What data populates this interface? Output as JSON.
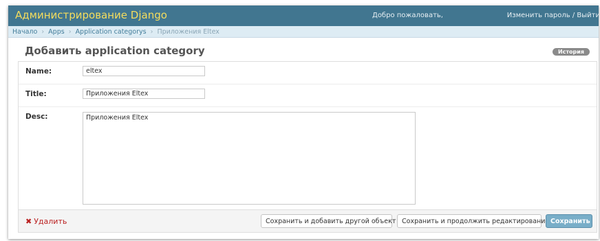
{
  "header": {
    "site_title": "Администрирование Django",
    "welcome": "Добро пожаловать,",
    "change_password": "Изменить пароль",
    "separator": "/",
    "logout": "Выйти"
  },
  "breadcrumbs": {
    "items": [
      "Начало",
      "Apps",
      "Application categorys",
      "Приложения Eltex"
    ],
    "separator": "›"
  },
  "page": {
    "title": "Добавить application category",
    "history_label": "История"
  },
  "form": {
    "name": {
      "label": "Name:",
      "value": "eltex"
    },
    "title": {
      "label": "Title:",
      "value": "Приложения Eltex"
    },
    "desc": {
      "label": "Desc:",
      "value": "Приложения Eltex"
    }
  },
  "submit_row": {
    "delete_icon": "✖",
    "delete_label": "Удалить",
    "save_add_another": "Сохранить и добавить другой объект",
    "save_continue": "Сохранить и продолжить редактирование",
    "save": "Сохранить"
  },
  "colors": {
    "header_bg": "#417690",
    "site_title": "#f5dd5d",
    "breadcrumbs_bg": "#ddecf4",
    "delete": "#ba2121",
    "primary_button": "#79aec8"
  }
}
